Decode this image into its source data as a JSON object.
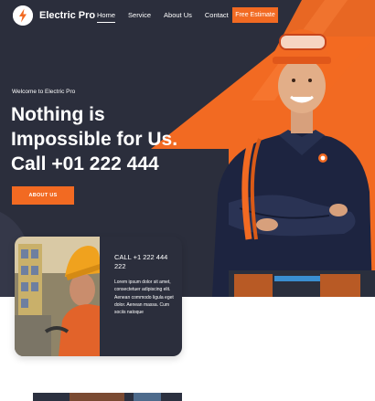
{
  "brand": {
    "name": "Electric Pro",
    "accent": "#f26a22",
    "dark": "#2b2e3c",
    "logo_icon": "lightning-bolt-icon"
  },
  "nav": {
    "items": [
      "Home",
      "Service",
      "About Us",
      "Contact"
    ],
    "active": "Home",
    "cta": "Free Estimate"
  },
  "hero": {
    "welcome": "Welcome to Electric Pro",
    "headline_1": "Nothing is",
    "headline_2": "Impossible for Us.",
    "headline_3": "Call +01 222 444",
    "button": "ABOUT US"
  },
  "contact_card": {
    "title": "CALL +1 222 444 222",
    "text": "Lorem ipsum dolor sit amet, consectetuer adipiscing elit. Aenean commodo ligula eget dolor. Aenean massa. Cum sociis natoque"
  }
}
